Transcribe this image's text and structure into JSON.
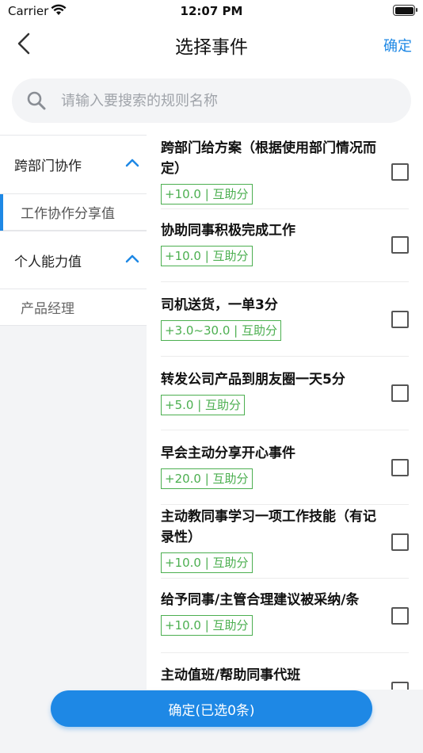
{
  "status_bar": {
    "carrier": "Carrier",
    "time": "12:07 PM"
  },
  "nav": {
    "title": "选择事件",
    "confirm": "确定",
    "back_icon": "chevron-left-icon"
  },
  "search": {
    "placeholder": "请输入要搜索的规则名称",
    "value": ""
  },
  "categories": [
    {
      "label": "跨部门协作",
      "expanded": true,
      "items": [
        {
          "label": "工作协作分享值",
          "active": true
        }
      ]
    },
    {
      "label": "个人能力值",
      "expanded": true,
      "items": [
        {
          "label": "产品经理",
          "active": false
        }
      ]
    }
  ],
  "events": [
    {
      "title": "跨部门给方案（根据使用部门情况而定）",
      "tag": "+10.0 | 互助分",
      "checked": false
    },
    {
      "title": "协助同事积极完成工作",
      "tag": "+10.0 | 互助分",
      "checked": false
    },
    {
      "title": "司机送货，一单3分",
      "tag": "+3.0~30.0 | 互助分",
      "checked": false
    },
    {
      "title": "转发公司产品到朋友圈一天5分",
      "tag": "+5.0 | 互助分",
      "checked": false
    },
    {
      "title": "早会主动分享开心事件",
      "tag": "+20.0 | 互助分",
      "checked": false
    },
    {
      "title": "主动教同事学习一项工作技能（有记录性）",
      "tag": "+10.0 | 互助分",
      "checked": false
    },
    {
      "title": "给予同事/主管合理建议被采纳/条",
      "tag": "+10.0 | 互助分",
      "checked": false
    },
    {
      "title": "主动值班/帮助同事代班",
      "tag": "",
      "checked": false
    }
  ],
  "footer": {
    "submit": "确定(已选0条)"
  },
  "colors": {
    "accent": "#1e88e5",
    "tag_green": "#4caf50",
    "panel_bg": "#f3f4f6"
  }
}
